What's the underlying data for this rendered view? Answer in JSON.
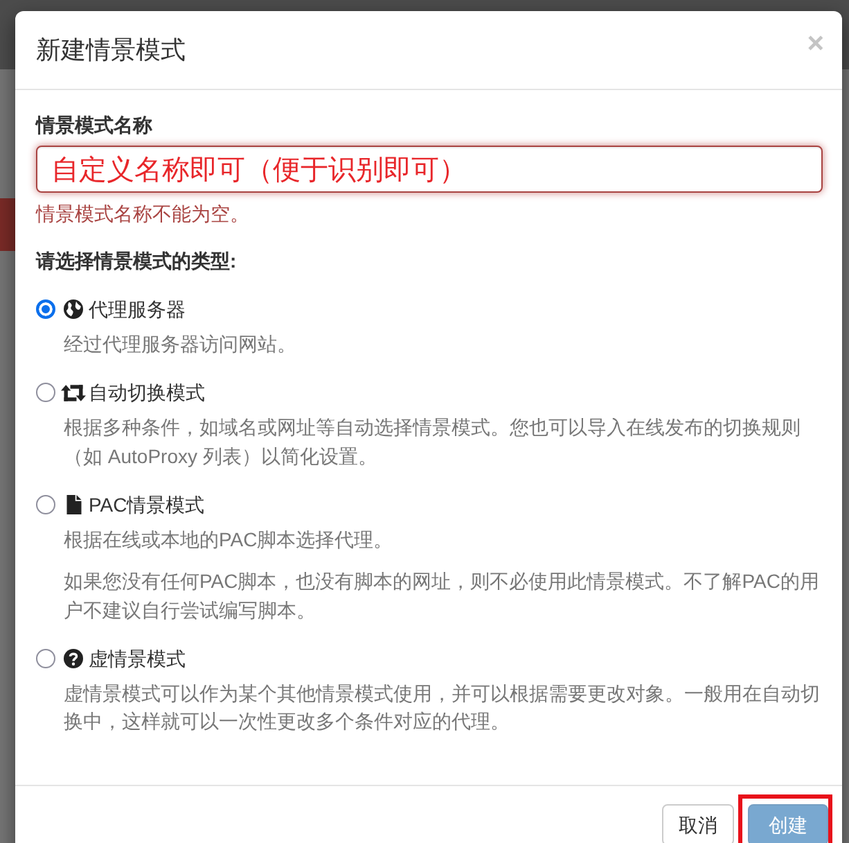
{
  "dialog": {
    "title": "新建情景模式",
    "close": "×"
  },
  "name_field": {
    "label": "情景模式名称",
    "value": "自定义名称即可（便于识别即可）",
    "invalid": true,
    "error": "情景模式名称不能为空。"
  },
  "type_prompt": "请选择情景模式的类型:",
  "profile_types": [
    {
      "kind": "proxy",
      "label": "代理服务器",
      "selected": true,
      "descriptions": [
        "经过代理服务器访问网站。"
      ]
    },
    {
      "kind": "switch",
      "label": "自动切换模式",
      "selected": false,
      "descriptions": [
        "根据多种条件，如域名或网址等自动选择情景模式。您也可以导入在线发布的切换规则（如 AutoProxy 列表）以简化设置。"
      ]
    },
    {
      "kind": "pac",
      "label": "PAC情景模式",
      "selected": false,
      "descriptions": [
        "根据在线或本地的PAC脚本选择代理。",
        "如果您没有任何PAC脚本，也没有脚本的网址，则不必使用此情景模式。不了解PAC的用户不建议自行尝试编写脚本。"
      ]
    },
    {
      "kind": "virtual",
      "label": "虚情景模式",
      "selected": false,
      "descriptions": [
        "虚情景模式可以作为某个其他情景模式使用，并可以根据需要更改对象。一般用在自动切换中，这样就可以一次性更改多个条件对应的代理。"
      ]
    }
  ],
  "buttons": [
    {
      "kind": "default",
      "label": "取消",
      "disabled": false,
      "highlighted": false
    },
    {
      "kind": "primary",
      "label": "创建",
      "disabled": true,
      "highlighted": true
    }
  ]
}
